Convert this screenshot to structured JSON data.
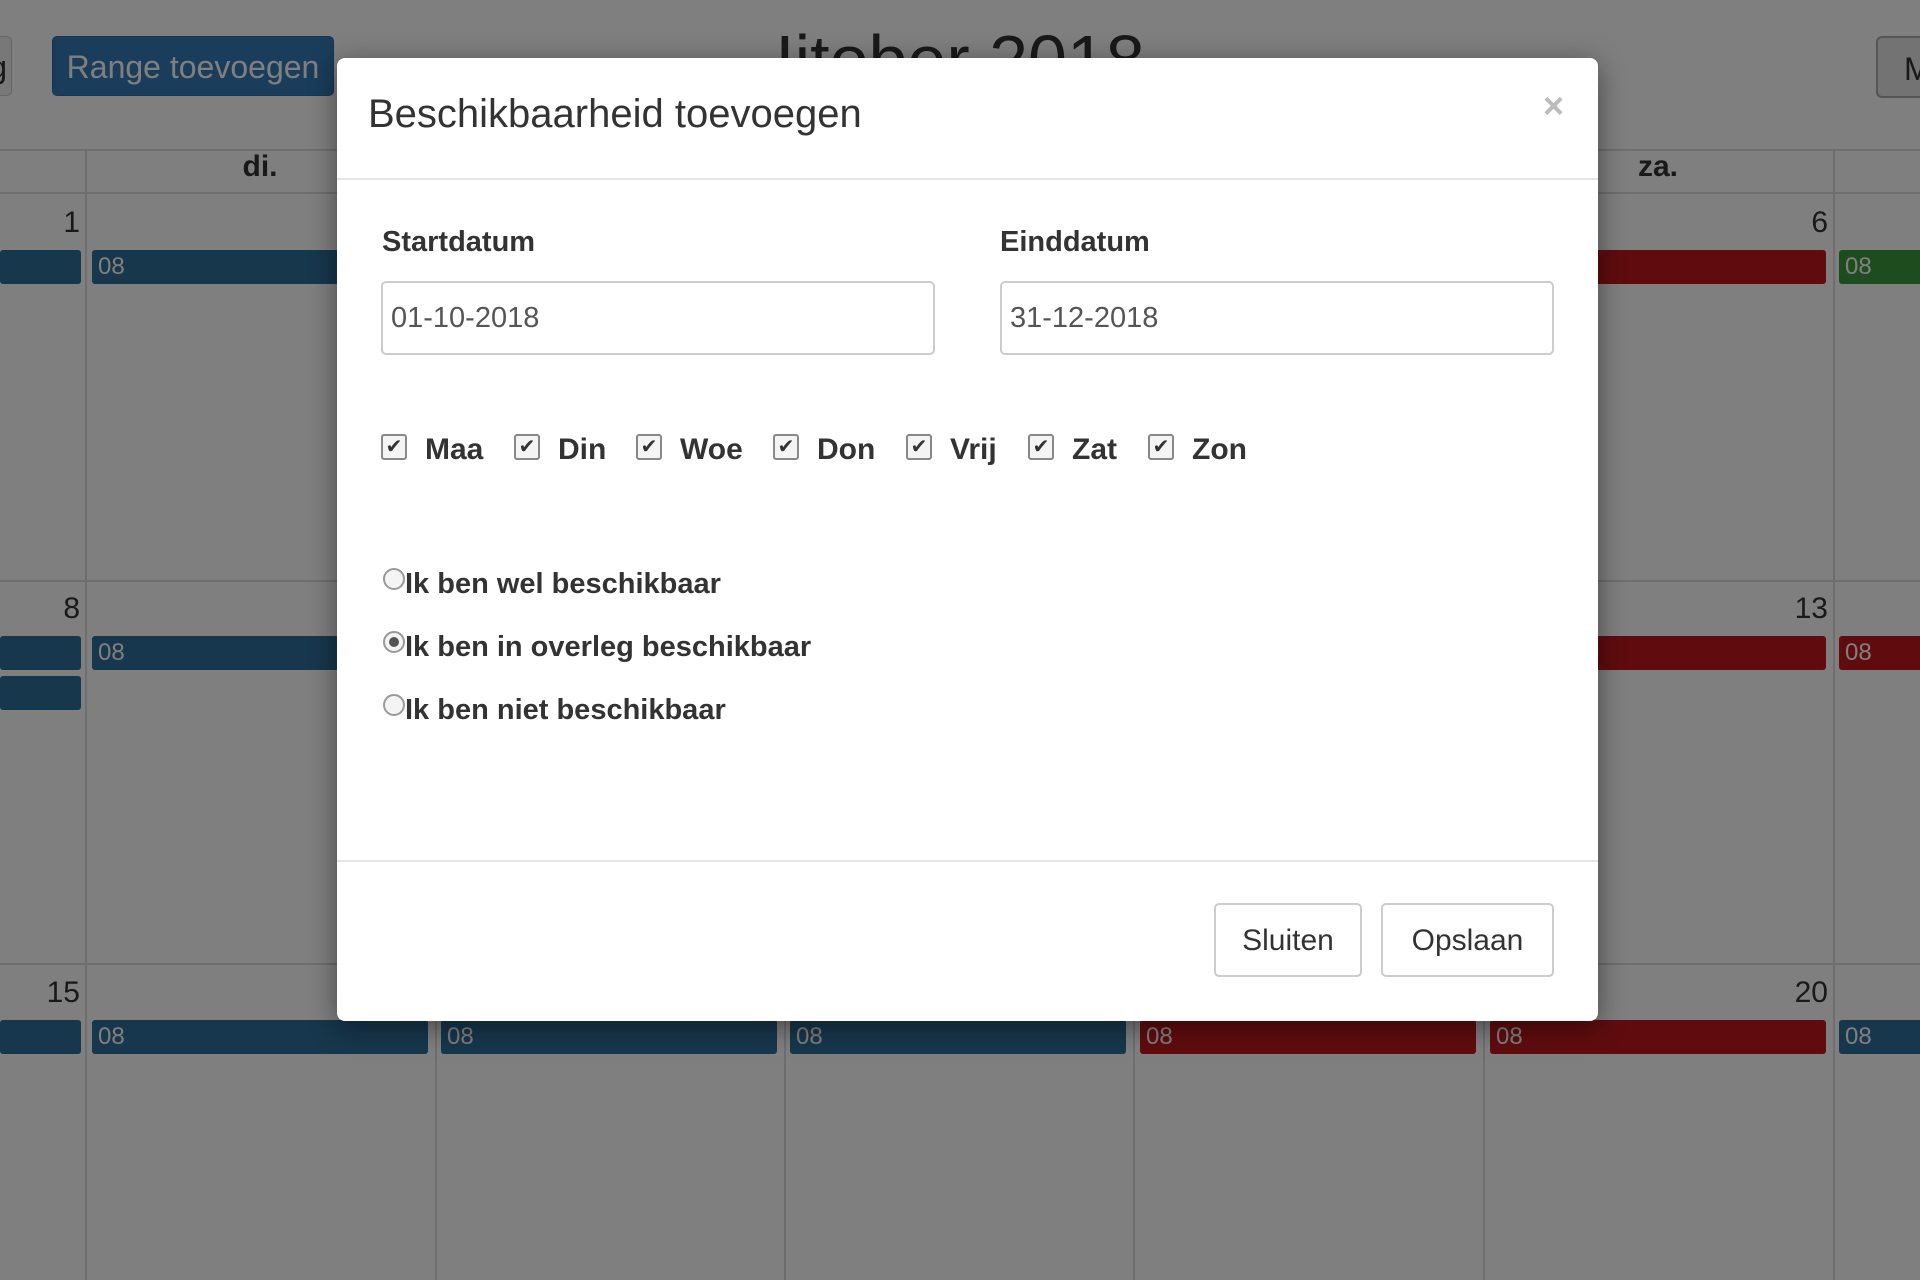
{
  "toolbar": {
    "left_partial_label": "g",
    "range_button_label": "Range toevoegen",
    "calendar_title": "Ijtober 2018",
    "right_partial_label": "M"
  },
  "calendar": {
    "column_headers": [
      "di.",
      "za."
    ],
    "week_rows": [
      {
        "day_left": "1",
        "day_right": "6"
      },
      {
        "day_left": "8",
        "day_right": "13"
      },
      {
        "day_left": "15",
        "day_right": "20"
      }
    ],
    "event_label": "08",
    "colors": {
      "available": "#2e6f98",
      "unavailable": "#c0191c",
      "other": "#3a9b3c"
    }
  },
  "modal": {
    "title": "Beschikbaarheid toevoegen",
    "close_icon": "close-icon",
    "start_label": "Startdatum",
    "start_value": "01-10-2018",
    "end_label": "Einddatum",
    "end_value": "31-12-2018",
    "days": [
      {
        "label": "Maa",
        "checked": true
      },
      {
        "label": "Din",
        "checked": true
      },
      {
        "label": "Woe",
        "checked": true
      },
      {
        "label": "Don",
        "checked": true
      },
      {
        "label": "Vrij",
        "checked": true
      },
      {
        "label": "Zat",
        "checked": true
      },
      {
        "label": "Zon",
        "checked": true
      }
    ],
    "availability_options": [
      {
        "label": "Ik ben wel beschikbaar",
        "selected": false
      },
      {
        "label": "Ik ben in overleg beschikbaar",
        "selected": true
      },
      {
        "label": "Ik ben niet beschikbaar",
        "selected": false
      }
    ],
    "close_button": "Sluiten",
    "save_button": "Opslaan"
  }
}
